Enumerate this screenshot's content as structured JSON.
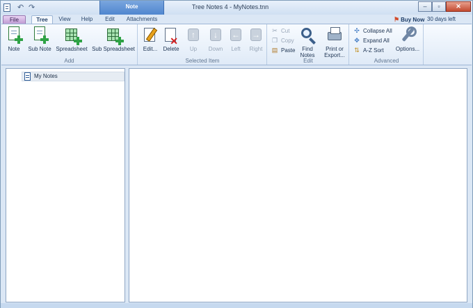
{
  "window": {
    "title": "Tree Notes 4 - MyNotes.tnn",
    "context_tab": "Note"
  },
  "tabs": [
    "File",
    "Tree",
    "View",
    "Help",
    "Edit",
    "Attachments"
  ],
  "buy_now": "Buy Now",
  "days_left": "30 days left",
  "groups": {
    "add": {
      "label": "Add",
      "buttons": [
        "Note",
        "Sub Note",
        "Spreadsheet",
        "Sub Spreadsheet"
      ]
    },
    "selected": {
      "label": "Selected Item",
      "buttons": [
        "Edit...",
        "Delete",
        "Up",
        "Down",
        "Left",
        "Right"
      ]
    },
    "edit": {
      "label": "Edit",
      "cut": "Cut",
      "copy": "Copy",
      "paste": "Paste",
      "find_l1": "Find",
      "find_l2": "Notes",
      "print_l1": "Print or",
      "print_l2": "Export..."
    },
    "advanced": {
      "label": "Advanced",
      "collapse": "Collapse All",
      "expand": "Expand All",
      "sort": "A-Z Sort",
      "options": "Options..."
    }
  },
  "tree": {
    "root": "My Notes"
  },
  "colors": {
    "accent": "#4f86cf",
    "ribbon_bg": "#dfeaf7",
    "plus_green": "#2ea245"
  },
  "icons": [
    "app-icon",
    "undo-icon",
    "redo-icon",
    "note-add-icon",
    "subnote-add-icon",
    "spreadsheet-icon",
    "sub-spreadsheet-icon",
    "edit-pencil-icon",
    "delete-icon",
    "up-arrow-icon",
    "down-arrow-icon",
    "left-arrow-icon",
    "right-arrow-icon",
    "cut-icon",
    "copy-icon",
    "paste-icon",
    "find-icon",
    "print-icon",
    "collapse-icon",
    "expand-icon",
    "sort-icon",
    "options-icon",
    "buy-now-icon"
  ]
}
